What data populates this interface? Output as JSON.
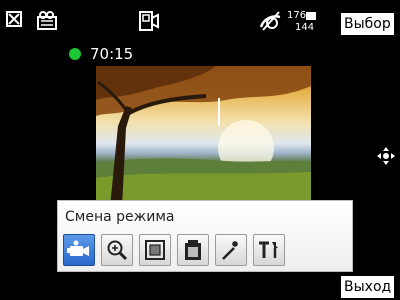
{
  "status": {
    "storage_top": "176",
    "storage_bottom": "144",
    "timer": "70:15"
  },
  "softkeys": {
    "right_top": "Выбор",
    "right_bottom": "Выход"
  },
  "mode_bar": {
    "title": "Смена режима",
    "buttons": [
      {
        "icon": "video-camera-icon",
        "active": true
      },
      {
        "icon": "zoom-icon",
        "active": false
      },
      {
        "icon": "frame-icon",
        "active": false
      },
      {
        "icon": "battery-icon",
        "active": false
      },
      {
        "icon": "flash-icon",
        "active": false
      },
      {
        "icon": "tools-icon",
        "active": false
      }
    ]
  },
  "colors": {
    "indicator": "#1ec534",
    "active_button": "#2a67c9",
    "background": "#000000"
  }
}
